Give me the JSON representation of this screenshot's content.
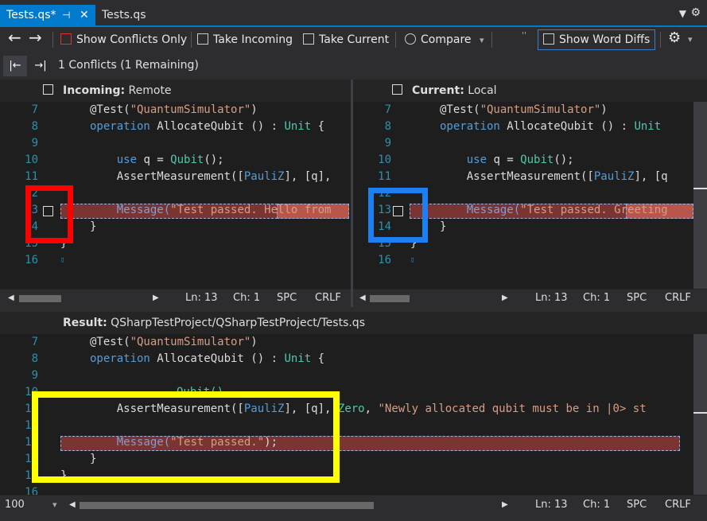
{
  "tabs": [
    {
      "label": "Tests.qs*",
      "pin": "⊣",
      "close": "✕",
      "active": true
    },
    {
      "label": "Tests.qs",
      "active": false
    }
  ],
  "tabstrip": {
    "menu_icon": "▼",
    "settings_icon": "⚙"
  },
  "toolbar": {
    "back_icon": "←",
    "forward_icon": "→",
    "show_conflicts_only": "Show Conflicts Only",
    "take_incoming": "Take Incoming",
    "take_current": "Take Current",
    "compare": "Compare",
    "compare_arrow": "▾",
    "overflow": "''",
    "show_word_diffs": "Show Word Diffs",
    "gear_icon": "⚙",
    "gear_arrow": "▾"
  },
  "navbar": {
    "prev_icon": "|←",
    "next_icon": "→|",
    "conflicts_text": "1 Conflicts (1 Remaining)"
  },
  "incoming": {
    "label": "Incoming:",
    "source": "Remote",
    "lines": [
      {
        "n": "7"
      },
      {
        "n": "8"
      },
      {
        "n": "9"
      },
      {
        "n": "10"
      },
      {
        "n": "11"
      },
      {
        "n": "12"
      },
      {
        "n": "13"
      },
      {
        "n": "14"
      },
      {
        "n": "15"
      },
      {
        "n": "16"
      }
    ],
    "code": {
      "l7a": "@Test(",
      "l7b": "\"QuantumSimulator\"",
      "l7c": ")",
      "l8a": "operation",
      "l8b": " AllocateQubit () : ",
      "l8c": "Unit",
      "l8d": " {",
      "l10a": "    use",
      "l10b": " q = ",
      "l10c": "Qubit",
      "l10d": "();",
      "l11a": "    AssertMeasurement([",
      "l11b": "PauliZ",
      "l11c": "], [q],",
      "l13a": "    Message(",
      "l13b": "\"Test passed. ",
      "l13c": "Hello from",
      "l14": "}",
      "l15": "}",
      "l16": "▯"
    },
    "status": {
      "left_arrow": "◀",
      "right_arrow": "▶",
      "ln": "Ln: 13",
      "ch": "Ch: 1",
      "spc": "SPC",
      "crlf": "CRLF"
    }
  },
  "current": {
    "label": "Current:",
    "source": "Local",
    "lines": [
      {
        "n": "7"
      },
      {
        "n": "8"
      },
      {
        "n": "9"
      },
      {
        "n": "10"
      },
      {
        "n": "11"
      },
      {
        "n": "12"
      },
      {
        "n": "13"
      },
      {
        "n": "14"
      },
      {
        "n": "15"
      },
      {
        "n": "16"
      }
    ],
    "code": {
      "l7a": "@Test(",
      "l7b": "\"QuantumSimulator\"",
      "l7c": ")",
      "l8a": "operation",
      "l8b": " AllocateQubit () : ",
      "l8c": "Unit",
      "l10a": "    use",
      "l10b": " q = ",
      "l10c": "Qubit",
      "l10d": "();",
      "l11a": "    AssertMeasurement([",
      "l11b": "PauliZ",
      "l11c": "], [q",
      "l13a": "    Message(",
      "l13b": "\"Test passed. ",
      "l13c": "Greeting",
      "l14": "}",
      "l15": "}",
      "l16": "▯"
    },
    "status": {
      "left_arrow": "◀",
      "right_arrow": "▶",
      "ln": "Ln: 13",
      "ch": "Ch: 1",
      "spc": "SPC",
      "crlf": "CRLF"
    }
  },
  "result": {
    "label": "Result:",
    "path": "QSharpTestProject/QSharpTestProject/Tests.qs",
    "lines": [
      {
        "n": "7"
      },
      {
        "n": "8"
      },
      {
        "n": "9"
      },
      {
        "n": "10"
      },
      {
        "n": "11"
      },
      {
        "n": "12"
      },
      {
        "n": "13"
      },
      {
        "n": "14"
      },
      {
        "n": "15"
      },
      {
        "n": "16"
      }
    ],
    "code": {
      "l7a": "@Test(",
      "l7b": "\"QuantumSimulator\"",
      "l7c": ")",
      "l8a": "operation",
      "l8b": " AllocateQubit () : ",
      "l8c": "Unit",
      "l8d": " {",
      "l10": "Qubit()",
      "l11a": "    AssertMeasurement([",
      "l11b": "PauliZ",
      "l11c": "], [q], ",
      "l11d": "Zero",
      "l11e": ", ",
      "l11f": "\"Newly allocated qubit must be in |0> st",
      "l13a": "    Message(",
      "l13b": "\"Test passed.\"",
      "l13c": ");",
      "l14": "}",
      "l15": "}"
    },
    "status": {
      "zoom": "100 %",
      "zoom_arrow": "▾",
      "left_arrow": "◀",
      "right_arrow": "▶",
      "ln": "Ln: 13",
      "ch": "Ch: 1",
      "spc": "SPC",
      "crlf": "CRLF"
    }
  },
  "colors": {
    "accent": "#007acc",
    "red_box": "#ff0000",
    "blue_box": "#1e7ff0",
    "yellow_box": "#ffff00",
    "diff_bg": "#7a3431"
  }
}
